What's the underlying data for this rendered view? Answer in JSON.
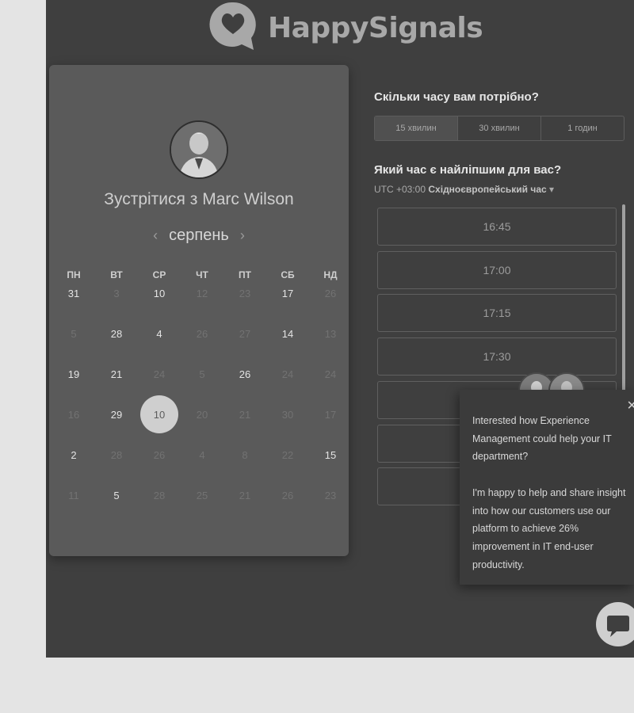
{
  "brand": {
    "name": "HappySignals",
    "logo_icon": "heart-speech-bubble-icon"
  },
  "organizer": {
    "meet_title": "Зустрітися з Marc Wilson",
    "month": "серпень",
    "prev_icon": "chevron-left-icon",
    "next_icon": "chevron-right-icon",
    "weekdays": [
      "ПН",
      "ВТ",
      "СР",
      "ЧТ",
      "ПТ",
      "СБ",
      "НД"
    ],
    "weeks": [
      [
        {
          "d": "31",
          "on": true
        },
        {
          "d": "3",
          "on": false
        },
        {
          "d": "10",
          "on": true
        },
        {
          "d": "12",
          "on": false
        },
        {
          "d": "23",
          "on": false
        },
        {
          "d": "17",
          "on": true
        },
        {
          "d": "26",
          "on": false
        }
      ],
      [
        {
          "d": "5",
          "on": false
        },
        {
          "d": "28",
          "on": true
        },
        {
          "d": "4",
          "on": true
        },
        {
          "d": "26",
          "on": false
        },
        {
          "d": "27",
          "on": false
        },
        {
          "d": "14",
          "on": true
        },
        {
          "d": "13",
          "on": false
        }
      ],
      [
        {
          "d": "19",
          "on": true
        },
        {
          "d": "21",
          "on": true
        },
        {
          "d": "24",
          "on": false
        },
        {
          "d": "5",
          "on": false
        },
        {
          "d": "26",
          "on": true
        },
        {
          "d": "24",
          "on": false
        },
        {
          "d": "24",
          "on": false
        }
      ],
      [
        {
          "d": "16",
          "on": false
        },
        {
          "d": "29",
          "on": true
        },
        {
          "d": "10",
          "on": true,
          "selected": true
        },
        {
          "d": "20",
          "on": false
        },
        {
          "d": "21",
          "on": false
        },
        {
          "d": "30",
          "on": false
        },
        {
          "d": "17",
          "on": false
        }
      ],
      [
        {
          "d": "2",
          "on": true
        },
        {
          "d": "28",
          "on": false
        },
        {
          "d": "26",
          "on": false
        },
        {
          "d": "4",
          "on": false
        },
        {
          "d": "8",
          "on": false
        },
        {
          "d": "22",
          "on": false
        },
        {
          "d": "15",
          "on": true
        }
      ],
      [
        {
          "d": "11",
          "on": false
        },
        {
          "d": "5",
          "on": true
        },
        {
          "d": "28",
          "on": false
        },
        {
          "d": "25",
          "on": false
        },
        {
          "d": "21",
          "on": false
        },
        {
          "d": "26",
          "on": false
        },
        {
          "d": "23",
          "on": false
        }
      ]
    ]
  },
  "duration": {
    "question": "Скільки часу вам потрібно?",
    "options": [
      "15 хвилин",
      "30 хвилин",
      "1 годин"
    ],
    "selected_index": 0
  },
  "time_pick": {
    "question": "Який час є найліпшим для вас?",
    "tz_offset": "UTC +03:00",
    "tz_name": "Східноєвропейський час",
    "tz_caret": "▾",
    "slots": [
      "16:45",
      "17:00",
      "17:15",
      "17:30",
      "",
      "",
      ""
    ]
  },
  "chat_popup": {
    "text_1": "Interested how Experience Management could help your IT department?",
    "text_2": "I'm happy to help and share insight into how our customers use our platform to achieve 26% improvement in IT end-user productivity.",
    "close_glyph": "✕"
  },
  "chat_button": {
    "icon": "chat-bubble-icon"
  }
}
